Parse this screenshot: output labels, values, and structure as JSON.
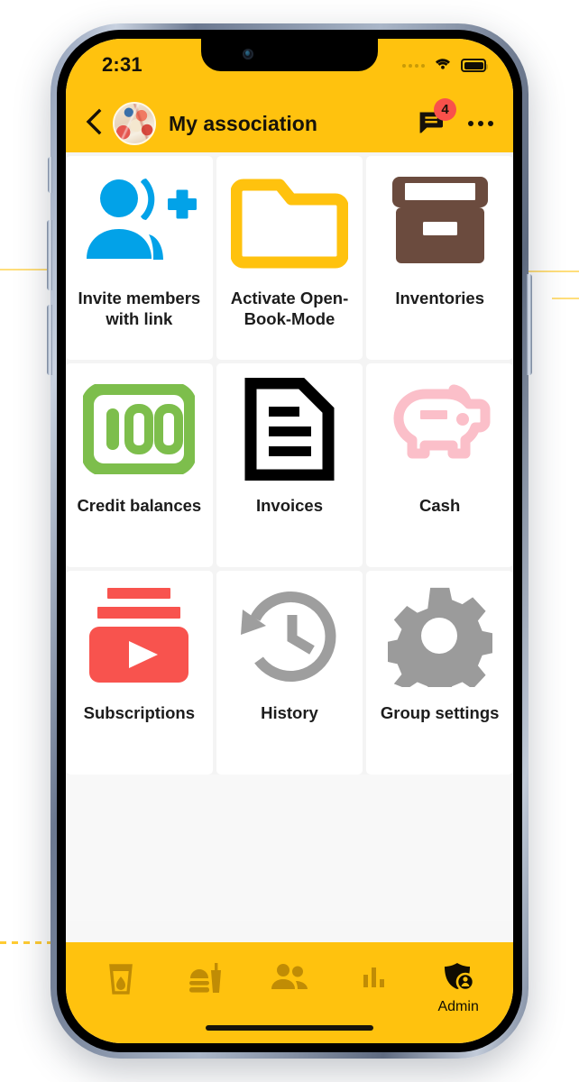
{
  "statusbar": {
    "time": "2:31",
    "signal_icon": "signal-dots-icon",
    "wifi_icon": "wifi-icon",
    "battery_icon": "battery-full-icon"
  },
  "header": {
    "back_icon": "chevron-left-icon",
    "avatar_name": "group-avatar",
    "title": "My association",
    "chat_icon": "chat-bubble-icon",
    "chat_badge": "4",
    "menu_icon": "overflow-menu-icon",
    "bg_color": "#FFC20E"
  },
  "tiles": [
    {
      "label": "Invite members with link",
      "icon": "person-add-icon",
      "icon_color": "#02A2E8",
      "name": "tile-invite-members"
    },
    {
      "label": "Activate Open-Book-Mode",
      "icon": "folder-icon",
      "icon_color": "#FFC20E",
      "name": "tile-open-book-mode"
    },
    {
      "label": "Inventories",
      "icon": "archive-box-icon",
      "icon_color": "#6B4B3E",
      "name": "tile-inventories"
    },
    {
      "label": "Credit balances",
      "icon": "banknote-100-icon",
      "icon_color": "#7DBE4C",
      "name": "tile-credit-balances"
    },
    {
      "label": "Invoices",
      "icon": "document-lines-icon",
      "icon_color": "#000000",
      "name": "tile-invoices"
    },
    {
      "label": "Cash",
      "icon": "piggy-bank-icon",
      "icon_color": "#FBBFC9",
      "name": "tile-cash"
    },
    {
      "label": "Subscriptions",
      "icon": "video-subscriptions-icon",
      "icon_color": "#F8534E",
      "name": "tile-subscriptions"
    },
    {
      "label": "History",
      "icon": "history-clock-icon",
      "icon_color": "#9E9E9E",
      "name": "tile-history"
    },
    {
      "label": "Group settings",
      "icon": "gear-icon",
      "icon_color": "#9B9B9B",
      "name": "tile-group-settings"
    }
  ],
  "bottomnav": {
    "bg_color": "#FFC20E",
    "inactive_color": "#C08C05",
    "active_color": "#100C02",
    "items": [
      {
        "icon": "drink-glass-icon",
        "label": "",
        "name": "nav-drinks",
        "active": false
      },
      {
        "icon": "fast-food-icon",
        "label": "",
        "name": "nav-food",
        "active": false
      },
      {
        "icon": "people-icon",
        "label": "",
        "name": "nav-members",
        "active": false
      },
      {
        "icon": "bar-chart-icon",
        "label": "",
        "name": "nav-statistics",
        "active": false
      },
      {
        "icon": "shield-admin-icon",
        "label": "Admin",
        "name": "nav-admin",
        "active": true
      }
    ]
  }
}
